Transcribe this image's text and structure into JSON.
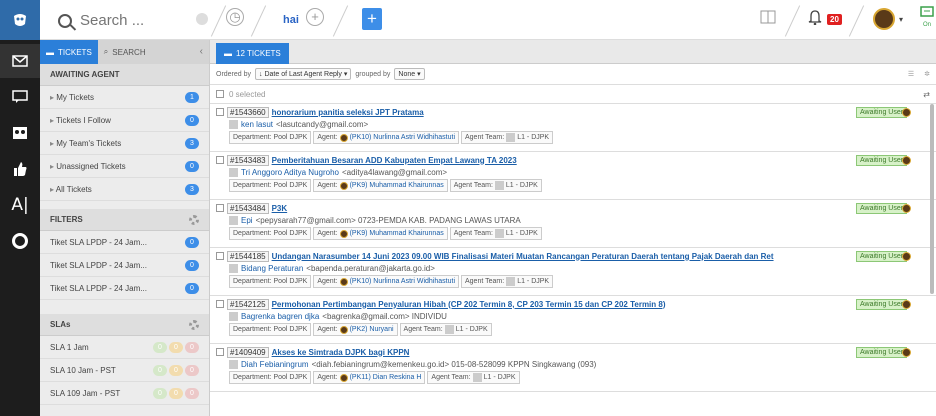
{
  "topbar": {
    "search_placeholder": "Search ...",
    "brand": "hai",
    "notification_count": "20",
    "online_label": "On"
  },
  "sidebar": {
    "tabs": [
      {
        "label": "TICKETS"
      },
      {
        "label": "SEARCH"
      }
    ],
    "awaiting_heading": "AWAITING AGENT",
    "awaiting_items": [
      {
        "label": "My Tickets",
        "count": "1"
      },
      {
        "label": "Tickets I Follow",
        "count": "0"
      },
      {
        "label": "My Team's Tickets",
        "count": "3"
      },
      {
        "label": "Unassigned Tickets",
        "count": "0"
      },
      {
        "label": "All Tickets",
        "count": "3"
      }
    ],
    "filters_heading": "FILTERS",
    "filters": [
      {
        "label": "Tiket SLA LPDP - 24 Jam...",
        "count": "0"
      },
      {
        "label": "Tiket SLA LPDP - 24 Jam...",
        "count": "0"
      },
      {
        "label": "Tiket SLA LPDP - 24 Jam...",
        "count": "0"
      }
    ],
    "slas_heading": "SLAs",
    "slas": [
      {
        "label": "SLA 1 Jam",
        "c1": "0",
        "c2": "0",
        "c3": "0"
      },
      {
        "label": "SLA 10 Jam - PST",
        "c1": "0",
        "c2": "0",
        "c3": "0"
      },
      {
        "label": "SLA 109 Jam - PST",
        "c1": "0",
        "c2": "0",
        "c3": "0"
      }
    ]
  },
  "main": {
    "tab_label": "12 TICKETS",
    "ordered_by": "Ordered by",
    "order_value": "↓ Date of Last Agent Reply",
    "grouped_by": "grouped by",
    "group_value": "None",
    "selected_text": "0 selected",
    "tickets": [
      {
        "id": "#1543660",
        "subject": "honorarium panitia seleksi JPT Pratama",
        "user": "ken lasut",
        "user_extra": "<lasutcandy@gmail.com>",
        "department": "Department: Pool DJPK",
        "agent": "(PK10) Nurlinna Astri Widhihastuti",
        "team": "L1 - DJPK",
        "status": "Awaiting User"
      },
      {
        "id": "#1543483",
        "subject": "Pemberitahuan Besaran ADD Kabupaten Empat Lawang TA 2023",
        "user": "Tri Anggoro Aditya Nugroho",
        "user_extra": "<aditya4lawang@gmail.com>",
        "department": "Department: Pool DJPK",
        "agent": "(PK9) Muhammad Khairunnas",
        "team": "L1 - DJPK",
        "status": "Awaiting User"
      },
      {
        "id": "#1543484",
        "subject": "P3K",
        "user": "Epi",
        "user_extra": "<pepysarah77@gmail.com> 0723-PEMDA KAB. PADANG LAWAS UTARA",
        "department": "Department: Pool DJPK",
        "agent": "(PK9) Muhammad Khairunnas",
        "team": "L1 - DJPK",
        "status": "Awaiting User"
      },
      {
        "id": "#1544185",
        "subject": "Undangan Narasumber 14 Juni 2023 09.00 WIB Finalisasi Materi Muatan Rancangan Peraturan Daerah tentang Pajak Daerah dan Ret",
        "user": "Bidang Peraturan",
        "user_extra": "<bapenda.peraturan@jakarta.go.id>",
        "department": "Department: Pool DJPK",
        "agent": "(PK10) Nurlinna Astri Widhihastuti",
        "team": "L1 - DJPK",
        "status": "Awaiting User"
      },
      {
        "id": "#1542125",
        "subject": "Permohonan Pertimbangan Penyaluran Hibah (CP 202 Termin 8, CP 203 Termin 15 dan CP 202 Termin 8)",
        "user": "Bagrenka bagren djka",
        "user_extra": "<bagrenka@gmail.com> INDIVIDU",
        "department": "Department: Pool DJPK",
        "agent": "(PK2) Nuryani",
        "team": "L1 - DJPK",
        "status": "Awaiting User"
      },
      {
        "id": "#1409409",
        "subject": "Akses ke Simtrada DJPK bagi KPPN",
        "user": "Diah Febianingrum",
        "user_extra": "<diah.febianingrum@kemenkeu.go.id> 015-08-528099 KPPN Singkawang (093)",
        "department": "Department: Pool DJPK",
        "agent": "(PK11) Dian Reskina H",
        "team": "L1 - DJPK",
        "status": "Awaiting User"
      }
    ]
  }
}
